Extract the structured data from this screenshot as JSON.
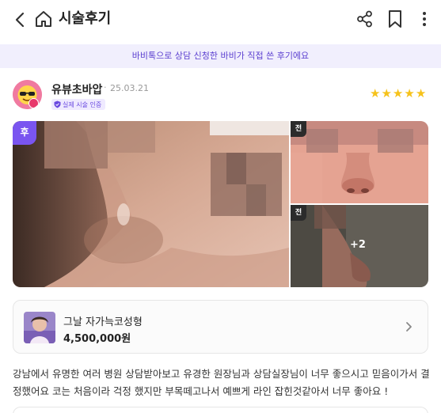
{
  "header": {
    "title": "시술후기",
    "back_icon": "chevron-left-icon",
    "home_icon": "home-icon",
    "share_icon": "share-icon",
    "bookmark_icon": "bookmark-icon",
    "more_icon": "more-vertical-icon"
  },
  "notice": "바비톡으로 상담 신청한 바비가 직접 쓴 후기에요",
  "review": {
    "username": "유뷰초바압",
    "separator": "·",
    "date": "25.03.21",
    "verified_label": "실제 시술 인증",
    "rating": 5,
    "star_color": "#f6c21a"
  },
  "photos": {
    "after_label": "후",
    "before_label_1": "전",
    "before_label_2": "전",
    "more_count": "+2"
  },
  "product": {
    "name": "그날 자가늑코성형",
    "price": "4,500,000원"
  },
  "content": "강남에서 유명한 여러 병원 상담받아보고 유경한 원장님과 상담실장님이 너무 좋으시고 믿음이가서 결정했어요 코는 처음이라 걱정 했지만 부목떼고나서 예쁘게 라인 잡힌것같아서 너무 좋아요 !",
  "colors": {
    "accent": "#7a55f0",
    "notice_bg": "#f1effd",
    "notice_text": "#5b3fd0"
  }
}
